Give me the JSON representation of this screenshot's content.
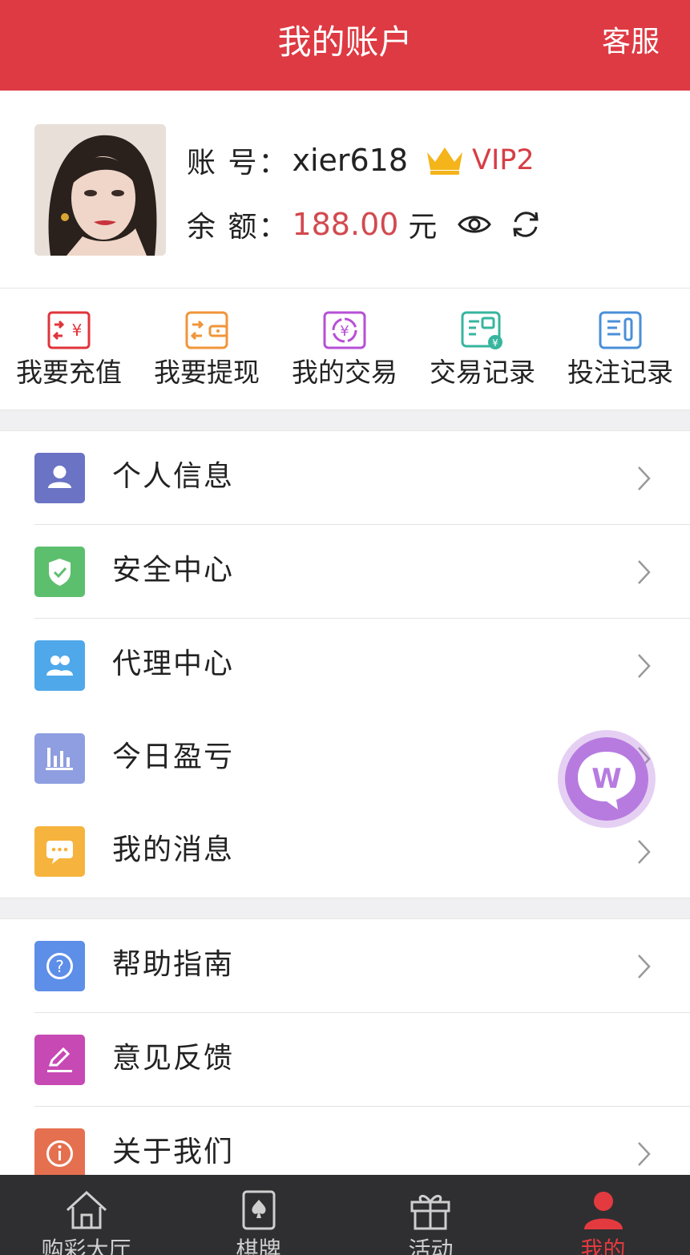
{
  "header": {
    "title": "我的账户",
    "service_label": "客服"
  },
  "profile": {
    "account_label": "账 号：",
    "account_value": "xier618",
    "vip_level": "VIP2",
    "balance_label": "余 额：",
    "balance_value": "188.00",
    "currency": "元"
  },
  "quick_actions": [
    {
      "label": "我要充值",
      "icon": "recharge-icon",
      "color": "#e0343b"
    },
    {
      "label": "我要提现",
      "icon": "withdraw-icon",
      "color": "#f0953a"
    },
    {
      "label": "我的交易",
      "icon": "transaction-icon",
      "color": "#b74fd6"
    },
    {
      "label": "交易记录",
      "icon": "transaction-record-icon",
      "color": "#37b59e"
    },
    {
      "label": "投注记录",
      "icon": "bet-record-icon",
      "color": "#4a8fd8"
    }
  ],
  "menu": {
    "group1": [
      {
        "label": "个人信息",
        "icon": "user-icon",
        "color": "#6a73c4"
      },
      {
        "label": "安全中心",
        "icon": "shield-icon",
        "color": "#5cbf6d"
      },
      {
        "label": "代理中心",
        "icon": "agent-icon",
        "color": "#4ea8ea"
      },
      {
        "label": "今日盈亏",
        "icon": "bar-chart-icon",
        "color": "#8e9ee0"
      },
      {
        "label": "我的消息",
        "icon": "message-icon",
        "color": "#f6b33d"
      }
    ],
    "group2": [
      {
        "label": "帮助指南",
        "icon": "help-icon",
        "color": "#5d8ee8"
      },
      {
        "label": "意见反馈",
        "icon": "feedback-icon",
        "color": "#c749b4"
      },
      {
        "label": "关于我们",
        "icon": "info-icon",
        "color": "#e5704f"
      }
    ]
  },
  "tabbar": [
    {
      "label": "购彩大厅",
      "icon": "home-icon",
      "active": false
    },
    {
      "label": "棋牌",
      "icon": "card-icon",
      "active": false
    },
    {
      "label": "活动",
      "icon": "gift-icon",
      "active": false
    },
    {
      "label": "我的",
      "icon": "user-profile-icon",
      "active": true
    }
  ],
  "colors": {
    "brand": "#de3a43",
    "balance": "#d24a4f",
    "tab_bg": "#2f2f31"
  }
}
